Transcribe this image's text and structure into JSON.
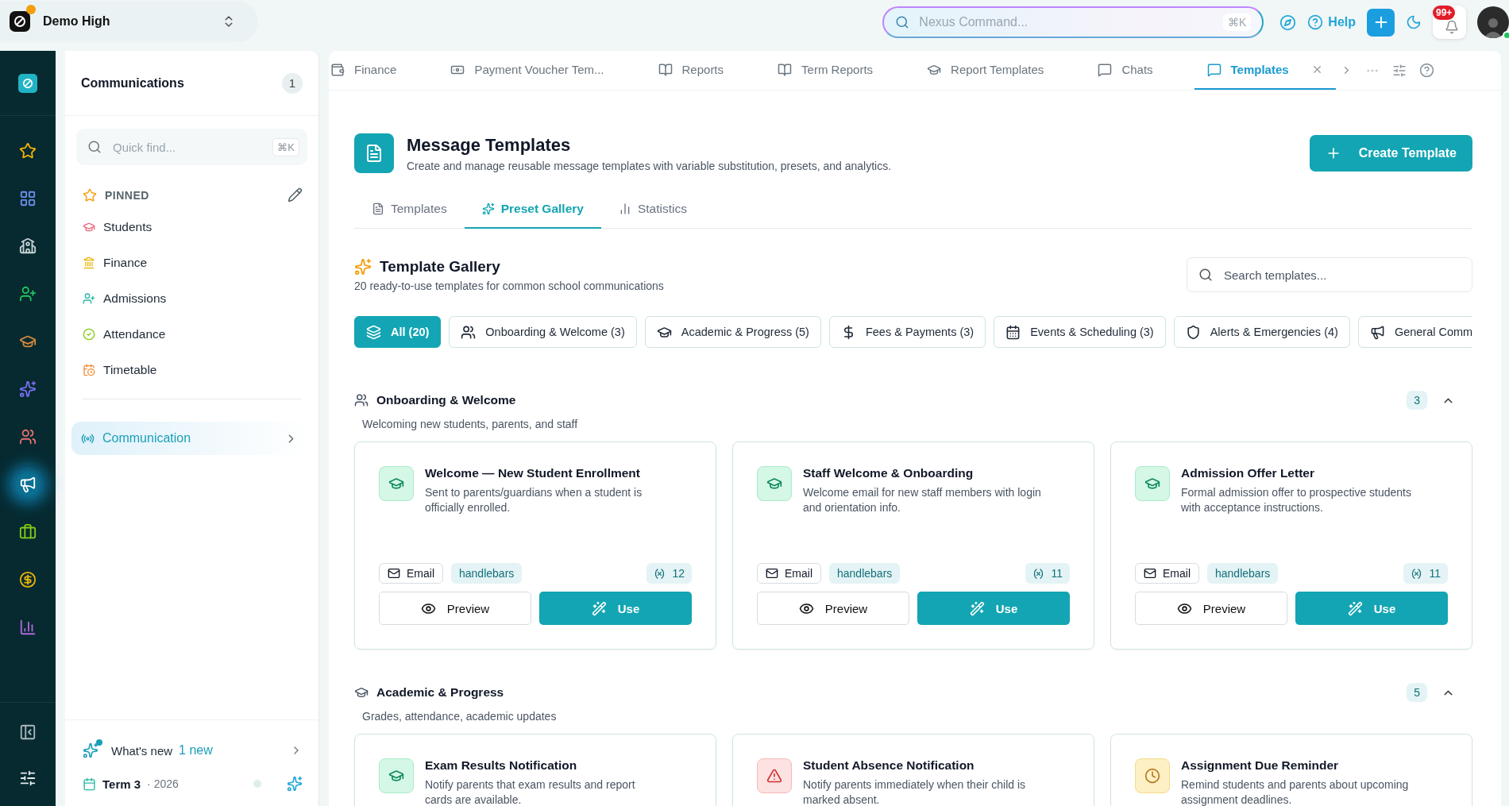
{
  "workspace": {
    "name": "Demo High"
  },
  "command": {
    "placeholder": "Nexus Command...",
    "shortcut": "⌘K"
  },
  "header_actions": {
    "help": "Help",
    "notifications": "99+"
  },
  "rail": [
    {
      "kind": "star",
      "selected": false
    },
    {
      "kind": "grid",
      "selected": false
    },
    {
      "kind": "school",
      "selected": false
    },
    {
      "kind": "admissions",
      "selected": false
    },
    {
      "kind": "academic",
      "selected": false
    },
    {
      "kind": "sparkles",
      "selected": false
    },
    {
      "kind": "people",
      "selected": false
    },
    {
      "kind": "megaphone",
      "selected": true
    },
    {
      "kind": "briefcase",
      "selected": false
    },
    {
      "kind": "money",
      "selected": false
    },
    {
      "kind": "chart",
      "selected": false
    }
  ],
  "sidebar": {
    "title": "Communications",
    "count": "1",
    "search": {
      "placeholder": "Quick find...",
      "shortcut": "⌘K"
    },
    "pinned_label": "PINNED",
    "pinned": [
      {
        "kind": "students",
        "label": "Students"
      },
      {
        "kind": "finance",
        "label": "Finance"
      },
      {
        "kind": "admissions",
        "label": "Admissions"
      },
      {
        "kind": "attendance",
        "label": "Attendance"
      },
      {
        "kind": "timetable",
        "label": "Timetable"
      }
    ],
    "modules": [
      {
        "label": "Communication",
        "selected": true
      }
    ],
    "whats_new": {
      "label": "What's new",
      "badge": "1 new"
    },
    "term": {
      "label": "Term 3",
      "year": "· 2026"
    }
  },
  "tabs": [
    {
      "kind": "money",
      "label": "Finance",
      "selected": false
    },
    {
      "kind": "voucher",
      "label": "Payment Voucher Tem...",
      "selected": false
    },
    {
      "kind": "book",
      "label": "Reports",
      "selected": false
    },
    {
      "kind": "book",
      "label": "Term Reports",
      "selected": false
    },
    {
      "kind": "cap",
      "label": "Report Templates",
      "selected": false
    },
    {
      "kind": "chat",
      "label": "Chats",
      "selected": false
    },
    {
      "kind": "chat",
      "label": "Templates",
      "selected": true
    }
  ],
  "page": {
    "title": "Message Templates",
    "subtitle": "Create and manage reusable message templates with variable substitution, presets, and analytics.",
    "create_button": "Create Template",
    "tabs": [
      {
        "kind": "list",
        "label": "Templates",
        "selected": false
      },
      {
        "kind": "gallery",
        "label": "Preset Gallery",
        "selected": true
      },
      {
        "kind": "stats",
        "label": "Statistics",
        "selected": false
      }
    ]
  },
  "gallery": {
    "title": "Template Gallery",
    "subtitle": "20 ready-to-use templates for common school communications",
    "search": {
      "placeholder": "Search templates..."
    },
    "filters": [
      {
        "kind": "all",
        "label": "All (20)",
        "selected": true
      },
      {
        "kind": "onboarding",
        "label": "Onboarding & Welcome (3)",
        "selected": false
      },
      {
        "kind": "academic",
        "label": "Academic & Progress (5)",
        "selected": false
      },
      {
        "kind": "fees",
        "label": "Fees & Payments (3)",
        "selected": false
      },
      {
        "kind": "events",
        "label": "Events & Scheduling (3)",
        "selected": false
      },
      {
        "kind": "alerts",
        "label": "Alerts & Emergencies (4)",
        "selected": false
      },
      {
        "kind": "general",
        "label": "General Comm",
        "selected": false
      }
    ],
    "sections": [
      {
        "kind": "onboarding",
        "title": "Onboarding & Welcome",
        "description": "Welcoming new students, parents, and staff",
        "count": "3",
        "expanded": true,
        "templates": [
          {
            "kind": "success",
            "title": "Welcome — New Student Enrollment",
            "description": "Sent to parents/guardians when a student is officially enrolled.",
            "channel": "Email",
            "engine": "handlebars",
            "variables": "12",
            "preview": "Preview",
            "use": "Use"
          },
          {
            "kind": "success",
            "title": "Staff Welcome & Onboarding",
            "description": "Welcome email for new staff members with login and orientation info.",
            "channel": "Email",
            "engine": "handlebars",
            "variables": "11",
            "preview": "Preview",
            "use": "Use"
          },
          {
            "kind": "success",
            "title": "Admission Offer Letter",
            "description": "Formal admission offer to prospective students with acceptance instructions.",
            "channel": "Email",
            "engine": "handlebars",
            "variables": "11",
            "preview": "Preview",
            "use": "Use"
          }
        ]
      },
      {
        "kind": "academic",
        "title": "Academic & Progress",
        "description": "Grades, attendance, academic updates",
        "count": "5",
        "expanded": true,
        "templates": [
          {
            "kind": "success",
            "title": "Exam Results Notification",
            "description": "Notify parents that exam results and report cards are available."
          },
          {
            "kind": "danger",
            "title": "Student Absence Notification",
            "description": "Notify parents immediately when their child is marked absent."
          },
          {
            "kind": "warning",
            "title": "Assignment Due Reminder",
            "description": "Remind students and parents about upcoming assignment deadlines."
          }
        ]
      }
    ]
  }
}
